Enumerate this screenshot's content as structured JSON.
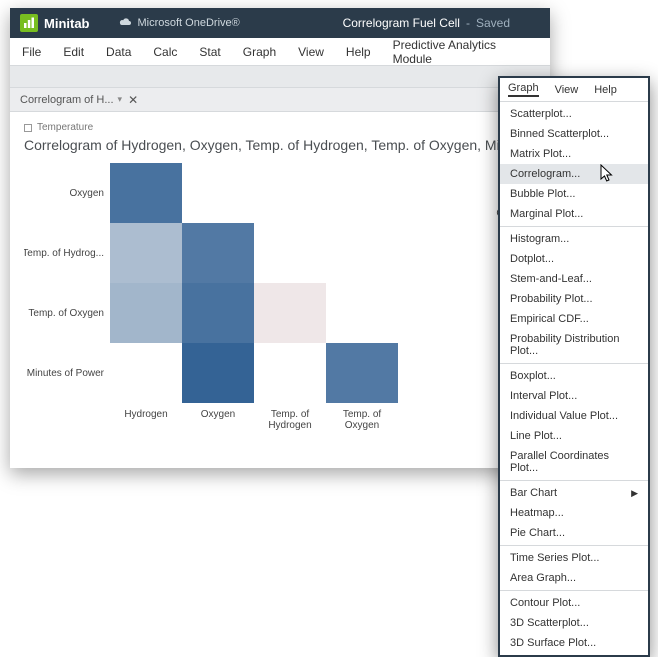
{
  "app": {
    "name": "Minitab",
    "location": "Microsoft OneDrive®",
    "doc_name": "Correlogram Fuel Cell",
    "doc_status": "Saved"
  },
  "menubar": {
    "file": "File",
    "edit": "Edit",
    "data": "Data",
    "calc": "Calc",
    "stat": "Stat",
    "graph": "Graph",
    "view": "View",
    "help": "Help",
    "predictive": "Predictive Analytics Module"
  },
  "tab": {
    "name": "Correlogram of H..."
  },
  "legend": {
    "label": "Temperature"
  },
  "chart_title": "Correlogram of Hydrogen, Oxygen, Temp. of Hydrogen, Temp. of Oxygen, Minutes of P",
  "color_legend": {
    "title": "Correl"
  },
  "chart_data": {
    "type": "heatmap",
    "y_categories": [
      "Oxygen",
      "Temp. of Hydrog...",
      "Temp. of Oxygen",
      "Minutes of Power"
    ],
    "x_categories": [
      "Hydrogen",
      "Oxygen",
      "Temp. of Hydrogen",
      "Temp. of Oxygen"
    ],
    "matrix": [
      [
        -0.85,
        null,
        null,
        null
      ],
      [
        -0.35,
        -0.8,
        null,
        null
      ],
      [
        -0.4,
        -0.85,
        0.05,
        null
      ],
      [
        null,
        -0.95,
        null,
        -0.8
      ]
    ],
    "value_range": [
      -1,
      1
    ],
    "color_low": "#2a5b90",
    "color_mid": "#f2f2f2",
    "color_high": "#b61a28",
    "title": "Correlogram of Hydrogen, Oxygen, Temp. of Hydrogen, Temp. of Oxygen, Minutes of Power"
  },
  "popup": {
    "menubar": {
      "graph": "Graph",
      "view": "View",
      "help": "Help"
    },
    "items": [
      "Scatterplot...",
      "Binned Scatterplot...",
      "Matrix Plot...",
      "Correlogram...",
      "Bubble Plot...",
      "Marginal Plot...",
      "Histogram...",
      "Dotplot...",
      "Stem-and-Leaf...",
      "Probability Plot...",
      "Empirical CDF...",
      "Probability Distribution Plot...",
      "Boxplot...",
      "Interval Plot...",
      "Individual Value Plot...",
      "Line Plot...",
      "Parallel Coordinates Plot...",
      "Bar Chart",
      "Heatmap...",
      "Pie Chart...",
      "Time Series Plot...",
      "Area Graph...",
      "Contour Plot...",
      "3D Scatterplot...",
      "3D Surface Plot..."
    ],
    "hovered_index": 3,
    "submenu_index": 17,
    "separators_after": [
      5,
      11,
      16,
      19,
      21
    ]
  }
}
